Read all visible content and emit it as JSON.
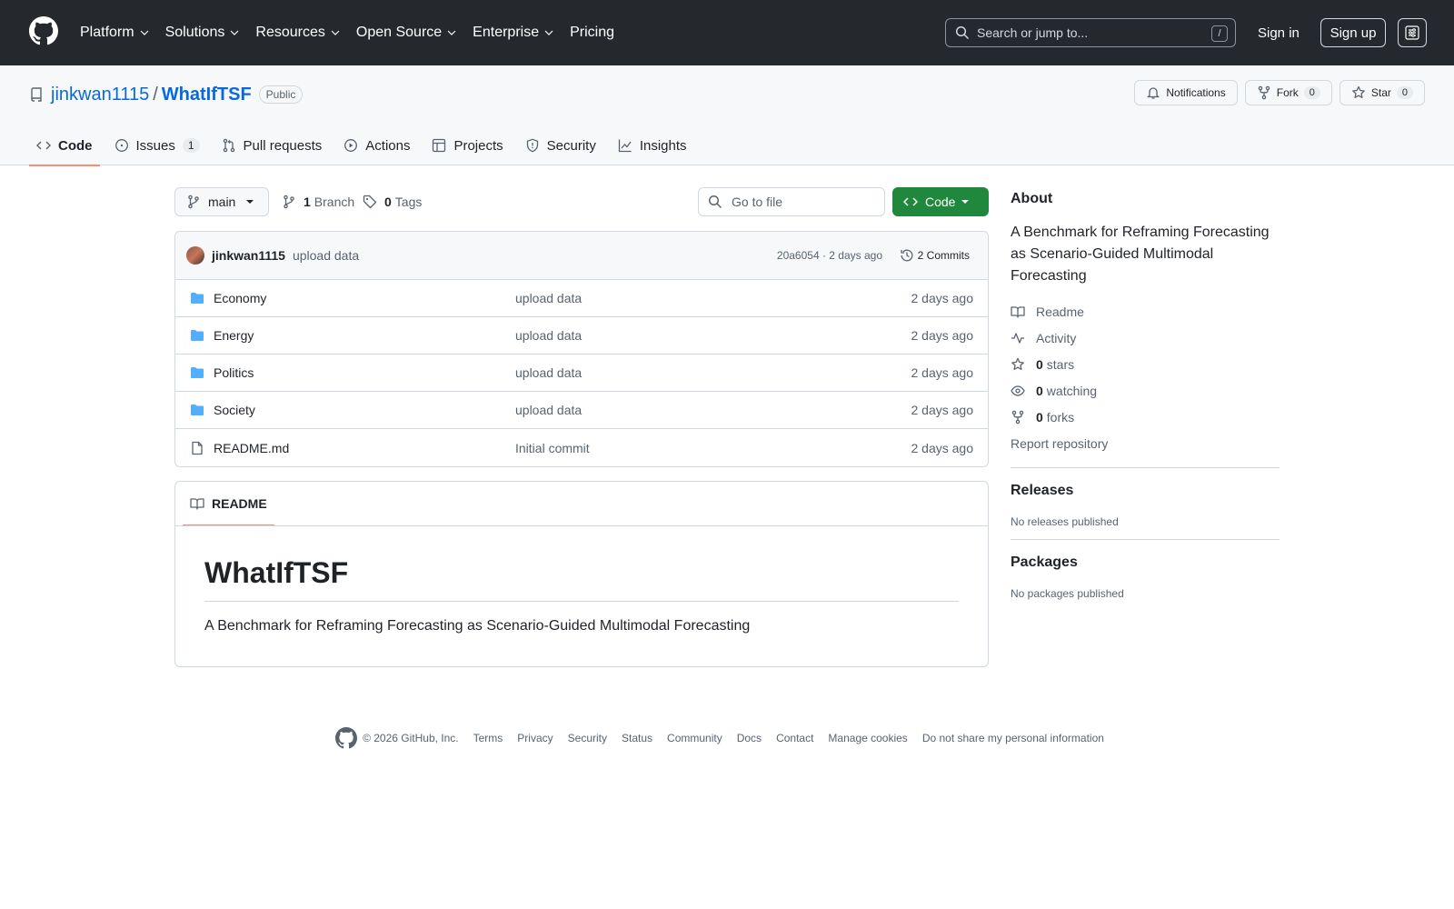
{
  "topnav": {
    "items": [
      "Platform",
      "Solutions",
      "Resources",
      "Open Source",
      "Enterprise",
      "Pricing"
    ],
    "search_placeholder": "Search or jump to...",
    "search_key": "/",
    "signin": "Sign in",
    "signup": "Sign up"
  },
  "repo": {
    "owner": "jinkwan1115",
    "separator": "/",
    "name": "WhatIfTSF",
    "visibility": "Public",
    "notifications_label": "Notifications",
    "fork_label": "Fork",
    "fork_count": "0",
    "star_label": "Star",
    "star_count": "0"
  },
  "tabs": [
    {
      "label": "Code",
      "active": true
    },
    {
      "label": "Issues",
      "count": "1"
    },
    {
      "label": "Pull requests"
    },
    {
      "label": "Actions"
    },
    {
      "label": "Projects"
    },
    {
      "label": "Security"
    },
    {
      "label": "Insights"
    }
  ],
  "toolbar": {
    "branch": "main",
    "branch_count": "1",
    "branch_label": "Branch",
    "tag_count": "0",
    "tag_label": "Tags",
    "gofile_placeholder": "Go to file",
    "code_button": "Code"
  },
  "commit": {
    "author": "jinkwan1115",
    "message": "upload data",
    "meta": "20a6054 · 2 days ago",
    "commits_label": "2 Commits"
  },
  "files": [
    {
      "name": "Economy",
      "type": "folder",
      "message": "upload data",
      "date": "2 days ago"
    },
    {
      "name": "Energy",
      "type": "folder",
      "message": "upload data",
      "date": "2 days ago"
    },
    {
      "name": "Politics",
      "type": "folder",
      "message": "upload data",
      "date": "2 days ago"
    },
    {
      "name": "Society",
      "type": "folder",
      "message": "upload data",
      "date": "2 days ago"
    },
    {
      "name": "README.md",
      "type": "file",
      "message": "Initial commit",
      "date": "2 days ago"
    }
  ],
  "readme": {
    "tab_label": "README",
    "heading": "WhatIfTSF",
    "body": "A Benchmark for Reframing Forecasting as Scenario-Guided Multimodal Forecasting"
  },
  "about": {
    "heading": "About",
    "description": "A Benchmark for Reframing Forecasting as Scenario-Guided Multimodal Forecasting",
    "readme": "Readme",
    "activity": "Activity",
    "stars_count": "0",
    "stars_label": "stars",
    "watching_count": "0",
    "watching_label": "watching",
    "forks_count": "0",
    "forks_label": "forks",
    "report": "Report repository"
  },
  "releases": {
    "heading": "Releases",
    "empty": "No releases published"
  },
  "packages": {
    "heading": "Packages",
    "empty": "No packages published"
  },
  "footer": {
    "copyright": "© 2026 GitHub, Inc.",
    "links": [
      "Terms",
      "Privacy",
      "Security",
      "Status",
      "Community",
      "Docs",
      "Contact",
      "Manage cookies",
      "Do not share my personal information"
    ]
  },
  "colors": {
    "header_bg": "#25292e",
    "link_blue": "#0969da",
    "primary_green": "#1f883d",
    "tab_underline": "#fd8c73",
    "folder_blue": "#54aeff"
  }
}
